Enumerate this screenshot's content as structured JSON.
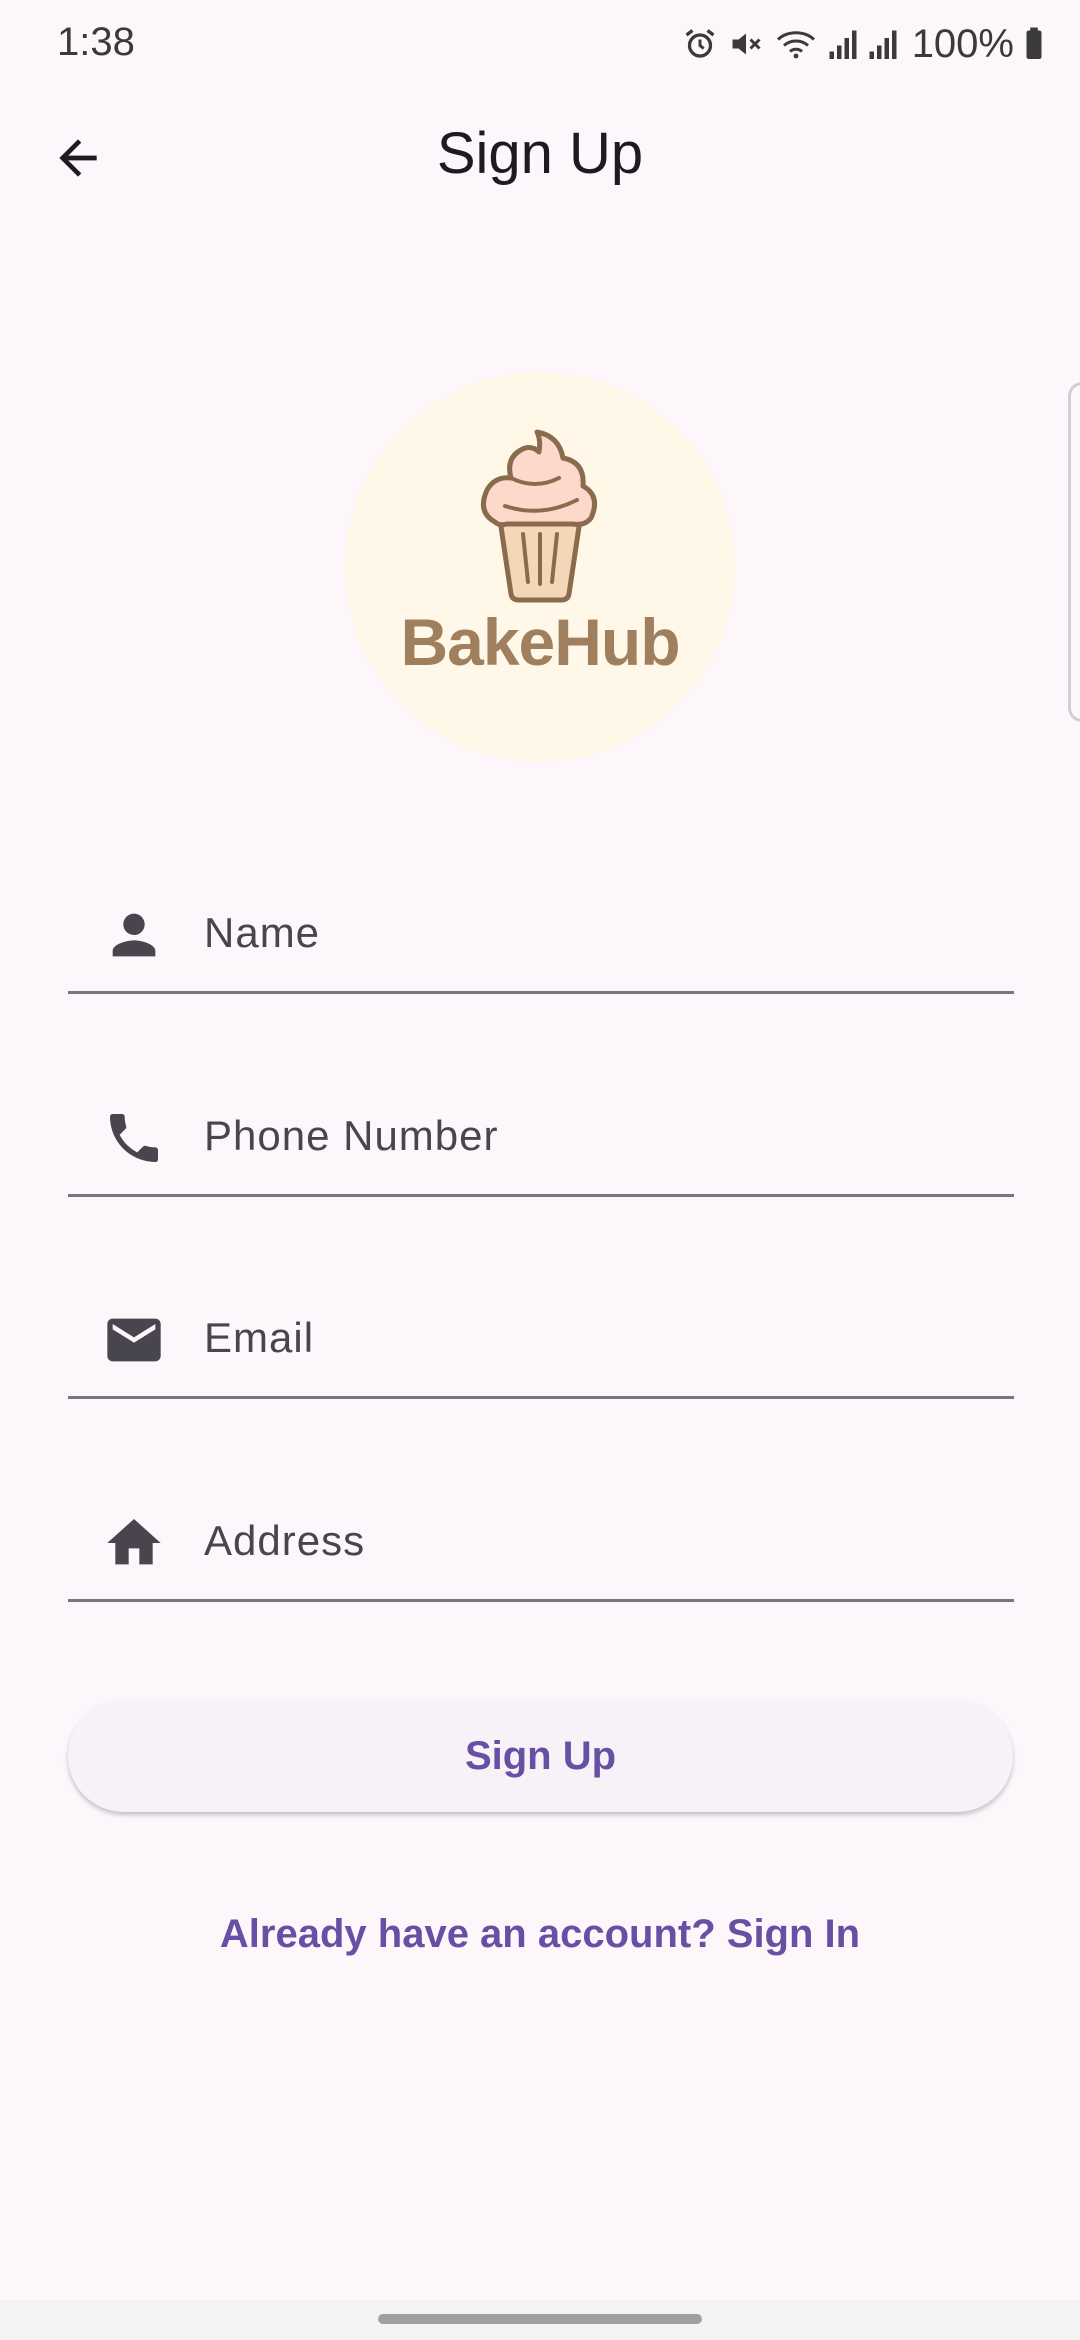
{
  "status_bar": {
    "time": "1:38",
    "battery": "100%",
    "icons": [
      "alarm-icon",
      "mute-icon",
      "wifi-icon",
      "signal-icon",
      "signal-icon",
      "battery-icon"
    ]
  },
  "app_bar": {
    "title": "Sign Up",
    "back_icon": "arrow-back-icon"
  },
  "logo": {
    "text": "BakeHub",
    "icon": "cupcake-icon"
  },
  "form": {
    "name": {
      "placeholder": "Name",
      "value": "",
      "icon": "person-icon"
    },
    "phone": {
      "placeholder": "Phone Number",
      "value": "",
      "icon": "phone-icon"
    },
    "email": {
      "placeholder": "Email",
      "value": "",
      "icon": "mail-icon"
    },
    "address": {
      "placeholder": "Address",
      "value": "",
      "icon": "home-icon"
    }
  },
  "actions": {
    "signup_label": "Sign Up",
    "signin_link": "Already have an account? Sign In"
  },
  "colors": {
    "background": "#fdf7fc",
    "primary": "#6750a4",
    "logo_circle": "#fff8e8",
    "logo_brown": "#a07f5e",
    "frosting": "#fcd9cb",
    "cup": "#f3d7b6"
  }
}
